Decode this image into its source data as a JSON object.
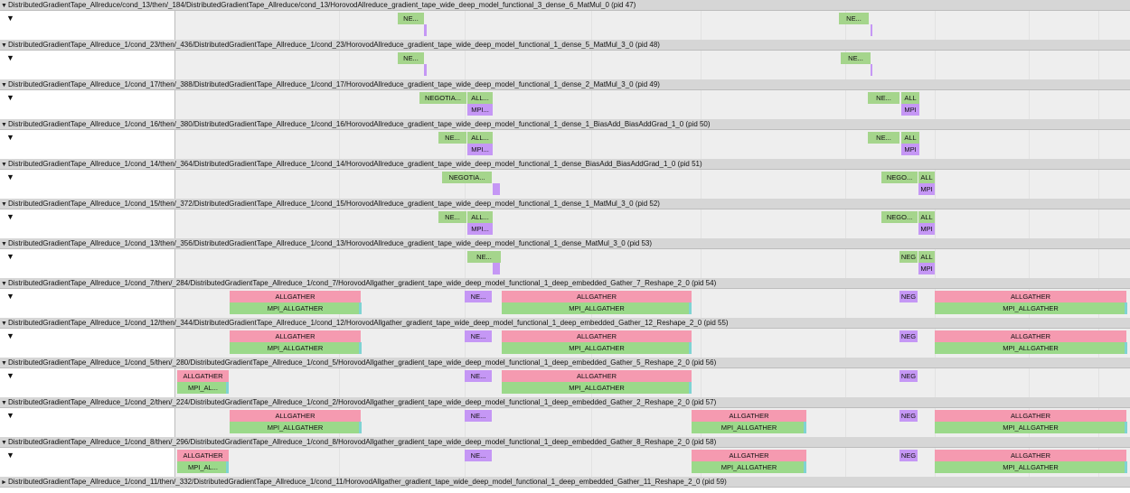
{
  "colors": {
    "negotiate": "#a5d58c",
    "allreduce": "#a5d58c",
    "mpi": "#c597f5",
    "allgather": "#f59ab0",
    "mpi_allgather": "#9bd98a",
    "tail": "#7fd3d3",
    "header_bg": "#d6d6d6",
    "track_bg": "#eeeeee"
  },
  "icons": {
    "expanded": "triangle-down-icon",
    "collapsed": "triangle-right-icon"
  },
  "glyphs": {
    "expanded": "▼",
    "collapsed": "►"
  },
  "processes": [
    {
      "title": "DistributedGradientTape_Allreduce/cond_13/then/_184/DistributedGradientTape_Allreduce/cond_13/HorovodAllreduce_gradient_tape_wide_deep_model_functional_3_dense_6_MatMul_0 (pid 47)"
    },
    {
      "title": "DistributedGradientTape_Allreduce_1/cond_23/then/_436/DistributedGradientTape_Allreduce_1/cond_23/HorovodAllreduce_gradient_tape_wide_deep_model_functional_1_dense_5_MatMul_3_0 (pid 48)"
    },
    {
      "title": "DistributedGradientTape_Allreduce_1/cond_17/then/_388/DistributedGradientTape_Allreduce_1/cond_17/HorovodAllreduce_gradient_tape_wide_deep_model_functional_1_dense_2_MatMul_3_0 (pid 49)"
    },
    {
      "title": "DistributedGradientTape_Allreduce_1/cond_16/then/_380/DistributedGradientTape_Allreduce_1/cond_16/HorovodAllreduce_gradient_tape_wide_deep_model_functional_1_dense_1_BiasAdd_BiasAddGrad_1_0 (pid 50)"
    },
    {
      "title": "DistributedGradientTape_Allreduce_1/cond_14/then/_364/DistributedGradientTape_Allreduce_1/cond_14/HorovodAllreduce_gradient_tape_wide_deep_model_functional_1_dense_BiasAdd_BiasAddGrad_1_0 (pid 51)"
    },
    {
      "title": "DistributedGradientTape_Allreduce_1/cond_15/then/_372/DistributedGradientTape_Allreduce_1/cond_15/HorovodAllreduce_gradient_tape_wide_deep_model_functional_1_dense_1_MatMul_3_0 (pid 52)"
    },
    {
      "title": "DistributedGradientTape_Allreduce_1/cond_13/then/_356/DistributedGradientTape_Allreduce_1/cond_13/HorovodAllreduce_gradient_tape_wide_deep_model_functional_1_dense_MatMul_3_0 (pid 53)"
    },
    {
      "title": "DistributedGradientTape_Allreduce_1/cond_7/then/_284/DistributedGradientTape_Allreduce_1/cond_7/HorovodAllgather_gradient_tape_wide_deep_model_functional_1_deep_embedded_Gather_7_Reshape_2_0 (pid 54)"
    },
    {
      "title": "DistributedGradientTape_Allreduce_1/cond_12/then/_344/DistributedGradientTape_Allreduce_1/cond_12/HorovodAllgather_gradient_tape_wide_deep_model_functional_1_deep_embedded_Gather_12_Reshape_2_0 (pid 55)"
    },
    {
      "title": "DistributedGradientTape_Allreduce_1/cond_5/then/_280/DistributedGradientTape_Allreduce_1/cond_5/HorovodAllgather_gradient_tape_wide_deep_model_functional_1_deep_embedded_Gather_5_Reshape_2_0 (pid 56)"
    },
    {
      "title": "DistributedGradientTape_Allreduce_1/cond_2/then/_224/DistributedGradientTape_Allreduce_1/cond_2/HorovodAllgather_gradient_tape_wide_deep_model_functional_1_deep_embedded_Gather_2_Reshape_2_0 (pid 57)"
    },
    {
      "title": "DistributedGradientTape_Allreduce_1/cond_8/then/_296/DistributedGradientTape_Allreduce_1/cond_8/HorovodAllgather_gradient_tape_wide_deep_model_functional_1_deep_embedded_Gather_8_Reshape_2_0 (pid 58)"
    },
    {
      "title": "DistributedGradientTape_Allreduce_1/cond_11/then/_332/DistributedGradientTape_Allreduce_1/cond_11/HorovodAllgather_gradient_tape_wide_deep_model_functional_1_deep_embedded_Gather_11_Reshape_2_0 (pid 59)"
    }
  ],
  "slices": [
    [
      {
        "label": "NE...",
        "kind": "negotiate"
      },
      {
        "label": "",
        "kind": "mpi"
      },
      {
        "label": "NE...",
        "kind": "negotiate"
      },
      {
        "label": "",
        "kind": "mpi"
      }
    ],
    [
      {
        "label": "NE...",
        "kind": "negotiate"
      },
      {
        "label": "",
        "kind": "mpi"
      },
      {
        "label": "NE...",
        "kind": "negotiate"
      },
      {
        "label": "",
        "kind": "mpi"
      }
    ],
    [
      {
        "label": "NEGOTIA...",
        "kind": "negotiate"
      },
      {
        "label": "ALL...",
        "kind": "allreduce"
      },
      {
        "label": "MPI...",
        "kind": "mpi"
      },
      {
        "label": "NE...",
        "kind": "negotiate"
      },
      {
        "label": "ALL",
        "kind": "allreduce"
      },
      {
        "label": "MPI",
        "kind": "mpi"
      }
    ],
    [
      {
        "label": "NE...",
        "kind": "negotiate"
      },
      {
        "label": "ALL...",
        "kind": "allreduce"
      },
      {
        "label": "MPI...",
        "kind": "mpi"
      },
      {
        "label": "NE...",
        "kind": "negotiate"
      },
      {
        "label": "ALL",
        "kind": "allreduce"
      },
      {
        "label": "MPI",
        "kind": "mpi"
      }
    ],
    [
      {
        "label": "NEGOTIA...",
        "kind": "negotiate"
      },
      {
        "label": "",
        "kind": "mpi"
      },
      {
        "label": "NEGO...",
        "kind": "negotiate"
      },
      {
        "label": "ALL",
        "kind": "allreduce"
      },
      {
        "label": "MPI",
        "kind": "mpi"
      }
    ],
    [
      {
        "label": "NE...",
        "kind": "negotiate"
      },
      {
        "label": "ALL...",
        "kind": "allreduce"
      },
      {
        "label": "MPI...",
        "kind": "mpi"
      },
      {
        "label": "NEGO...",
        "kind": "negotiate"
      },
      {
        "label": "ALL",
        "kind": "allreduce"
      },
      {
        "label": "MPI",
        "kind": "mpi"
      }
    ],
    [
      {
        "label": "NE...",
        "kind": "negotiate"
      },
      {
        "label": "",
        "kind": "mpi"
      },
      {
        "label": "NEG",
        "kind": "negotiate"
      },
      {
        "label": "ALL",
        "kind": "allreduce"
      },
      {
        "label": "MPI",
        "kind": "mpi"
      }
    ],
    [
      {
        "label": "ALLGATHER",
        "kind": "allgather"
      },
      {
        "label": "MPI_ALLGATHER",
        "kind": "mpi_allgather"
      },
      {
        "label": "NE...",
        "kind": "mpi"
      },
      {
        "label": "ALLGATHER",
        "kind": "allgather"
      },
      {
        "label": "MPI_ALLGATHER",
        "kind": "mpi_allgather"
      },
      {
        "label": "NEG",
        "kind": "mpi"
      },
      {
        "label": "ALLGATHER",
        "kind": "allgather"
      },
      {
        "label": "MPI_ALLGATHER",
        "kind": "mpi_allgather"
      }
    ],
    [
      {
        "label": "ALLGATHER",
        "kind": "allgather"
      },
      {
        "label": "MPI_ALLGATHER",
        "kind": "mpi_allgather"
      },
      {
        "label": "NE...",
        "kind": "mpi"
      },
      {
        "label": "ALLGATHER",
        "kind": "allgather"
      },
      {
        "label": "MPI_ALLGATHER",
        "kind": "mpi_allgather"
      },
      {
        "label": "NEG",
        "kind": "mpi"
      },
      {
        "label": "ALLGATHER",
        "kind": "allgather"
      },
      {
        "label": "MPI_ALLGATHER",
        "kind": "mpi_allgather"
      }
    ],
    [
      {
        "label": "ALLGATHER",
        "kind": "allgather"
      },
      {
        "label": "MPI_AL...",
        "kind": "mpi_allgather"
      },
      {
        "label": "NE...",
        "kind": "mpi"
      },
      {
        "label": "ALLGATHER",
        "kind": "allgather"
      },
      {
        "label": "MPI_ALLGATHER",
        "kind": "mpi_allgather"
      },
      {
        "label": "NEG",
        "kind": "mpi"
      }
    ],
    [
      {
        "label": "ALLGATHER",
        "kind": "allgather"
      },
      {
        "label": "MPI_ALLGATHER",
        "kind": "mpi_allgather"
      },
      {
        "label": "NE...",
        "kind": "mpi"
      },
      {
        "label": "ALLGATHER",
        "kind": "allgather"
      },
      {
        "label": "MPI_ALLGATHER",
        "kind": "mpi_allgather"
      },
      {
        "label": "NEG",
        "kind": "mpi"
      },
      {
        "label": "ALLGATHER",
        "kind": "allgather"
      },
      {
        "label": "MPI_ALLGATHER",
        "kind": "mpi_allgather"
      }
    ],
    [
      {
        "label": "ALLGATHER",
        "kind": "allgather"
      },
      {
        "label": "MPI_AL...",
        "kind": "mpi_allgather"
      },
      {
        "label": "NE...",
        "kind": "mpi"
      },
      {
        "label": "ALLGATHER",
        "kind": "allgather"
      },
      {
        "label": "MPI_ALLGATHER",
        "kind": "mpi_allgather"
      },
      {
        "label": "NEG",
        "kind": "mpi"
      },
      {
        "label": "ALLGATHER",
        "kind": "allgather"
      },
      {
        "label": "MPI_ALLGATHER",
        "kind": "mpi_allgather"
      }
    ]
  ]
}
